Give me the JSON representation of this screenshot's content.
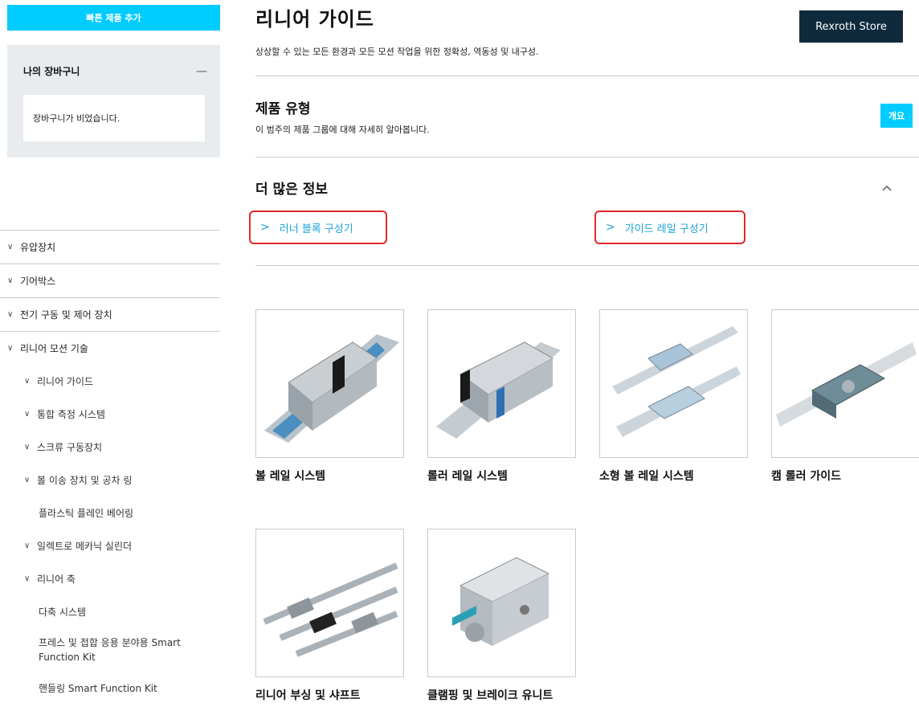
{
  "sidebar": {
    "quick_add_label": "빠른 제품 추가",
    "cart": {
      "title": "나의 장바구니",
      "toggle": "—",
      "empty_text": "장바구니가 비었습니다."
    },
    "nav": [
      "유압장치",
      "기어박스",
      "전기 구동 및 제어 장치",
      "리니어 모션 기술"
    ],
    "sub_items": [
      "리니어 가이드",
      "통합 측정 시스템",
      "스크류 구동장치",
      "볼 이송 장치 및 공차 링",
      "플라스틱 플레인 베어링",
      "일렉트로 메카닉 실린더",
      "리니어 축",
      "다축 시스템",
      "프레스 및 접합 응용 분야용 Smart",
      "Function Kit",
      "핸들링 Smart Function Kit"
    ]
  },
  "main": {
    "title": "리니어 가이드",
    "subtitle": "상상할 수 있는 모든 환경과 모든 모션 작업을 위한 정확성, 역동성 및 내구성.",
    "store_button": "Rexroth Store",
    "product_type": {
      "title": "제품 유형",
      "description": "이 범주의 제품 그룹에 대해 자세히 알아봅니다.",
      "overview_button": "개요"
    },
    "more_info": {
      "title": "더 많은 정보",
      "links": [
        "러너 블록 구성기",
        "가이드 레일 구성기"
      ]
    },
    "products": [
      "볼 레일 시스템",
      "롤러 레일 시스템",
      "소형 볼 레일 시스템",
      "캠 롤러 가이드",
      "리니어 부싱 및 샤프트",
      "클램핑 및 브레이크 유니트"
    ]
  },
  "colors": {
    "accent": "#00ccff",
    "store": "#0f2a3c",
    "highlight": "#e1282a",
    "link": "#1aa3d9"
  }
}
